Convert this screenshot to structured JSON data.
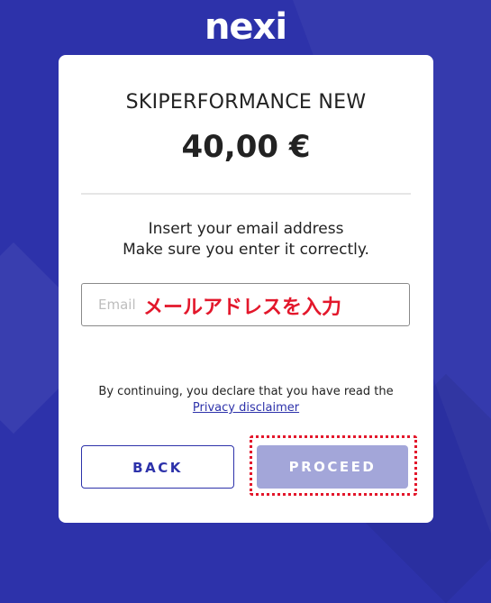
{
  "brand": {
    "logo_text": "nexi"
  },
  "merchant": {
    "name": "SKIPERFORMANCE NEW",
    "amount": "40,00 €"
  },
  "instructions": {
    "line1": "Insert your email address",
    "line2": "Make sure you enter it correctly."
  },
  "email": {
    "placeholder": "Email",
    "annotation": "メールアドレスを入力"
  },
  "disclaimer": {
    "text": "By continuing, you declare that you have read the",
    "link": "Privacy disclaimer"
  },
  "buttons": {
    "back": "BACK",
    "proceed": "PROCEED"
  },
  "colors": {
    "brand_blue": "#2d32aa",
    "proceed_disabled": "#a3a6d9",
    "annotation_red": "#e3172b"
  }
}
